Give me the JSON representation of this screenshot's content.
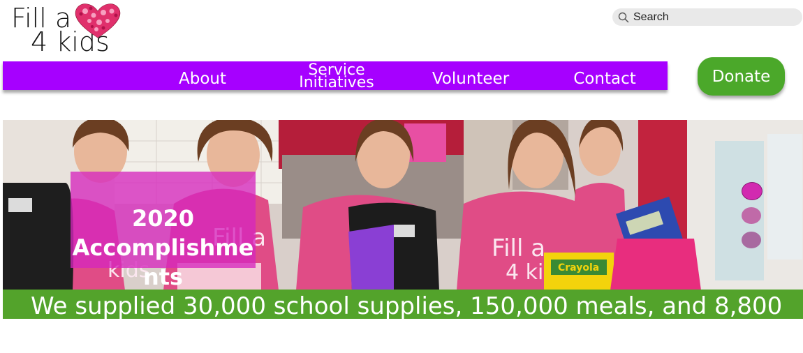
{
  "logo": {
    "line1": "Fill a",
    "line2": "4 kids",
    "heart_icon": "hearts-cluster-icon",
    "heart_color": "#e0306c"
  },
  "search": {
    "placeholder": "Search",
    "icon": "search-icon"
  },
  "nav": {
    "background": "#a600ff",
    "items": [
      {
        "label": "About"
      },
      {
        "label_line1": "Service",
        "label_line2": "Initiatives"
      },
      {
        "label": "Volunteer"
      },
      {
        "label": "Contact"
      }
    ]
  },
  "donate": {
    "label": "Donate",
    "color": "#4ba82a"
  },
  "hero": {
    "caption_line1": "2020",
    "caption_line2": "Accomplishme",
    "caption_line3": "nts",
    "caption_color": "#d628be",
    "shirt_text": "Fill a 4 kids",
    "crayon_label": "Crayola",
    "slides": 3,
    "active_slide": 1
  },
  "banner": {
    "text": "We supplied 30,000 school supplies, 150,000 meals, and 8,800",
    "color": "#53a32b"
  }
}
